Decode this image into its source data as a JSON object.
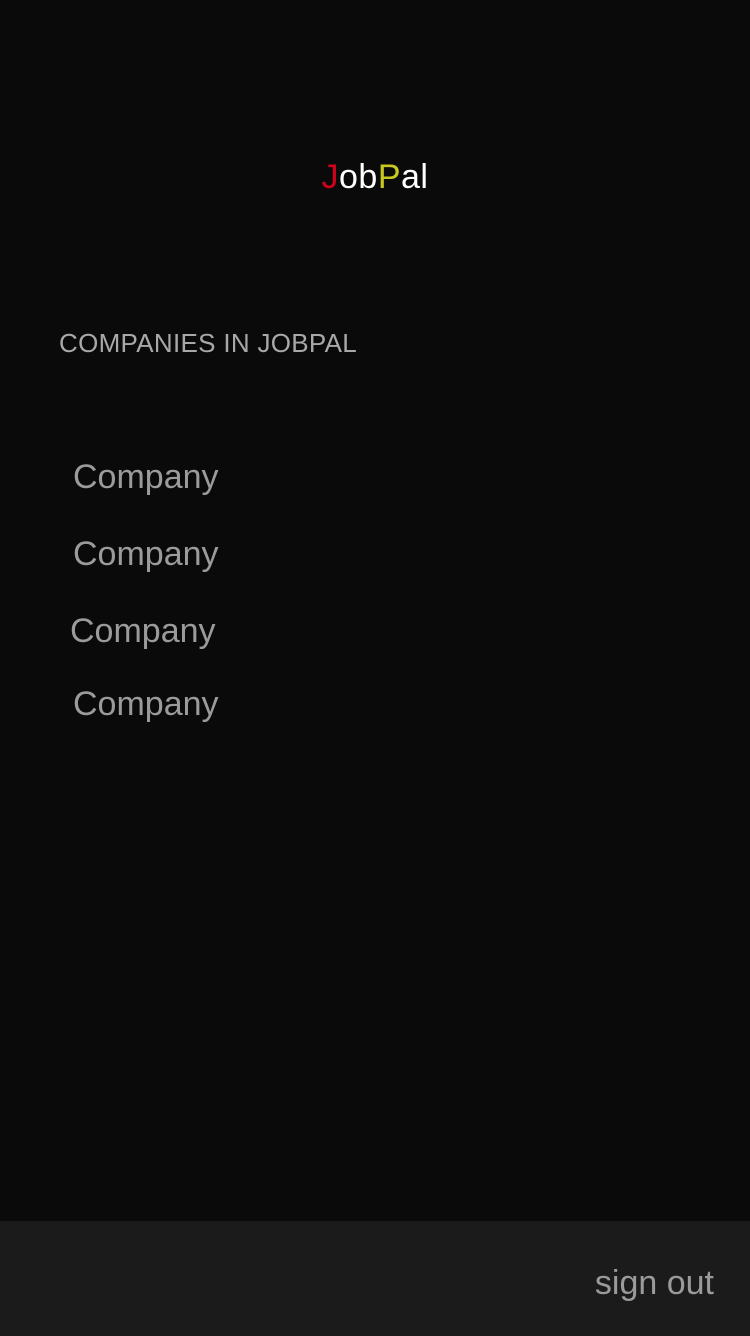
{
  "app": {
    "logo_parts": [
      {
        "text": "J",
        "color": "#d0021b"
      },
      {
        "text": "ob",
        "color": "#ffffff"
      },
      {
        "text": "P",
        "color": "#c8c81e"
      },
      {
        "text": "al",
        "color": "#ffffff"
      }
    ]
  },
  "main": {
    "section_title": "COMPANIES IN JOBPAL",
    "companies": [
      "Company",
      "Company",
      "Company",
      "Company"
    ]
  },
  "footer": {
    "sign_out_label": "sign out"
  }
}
